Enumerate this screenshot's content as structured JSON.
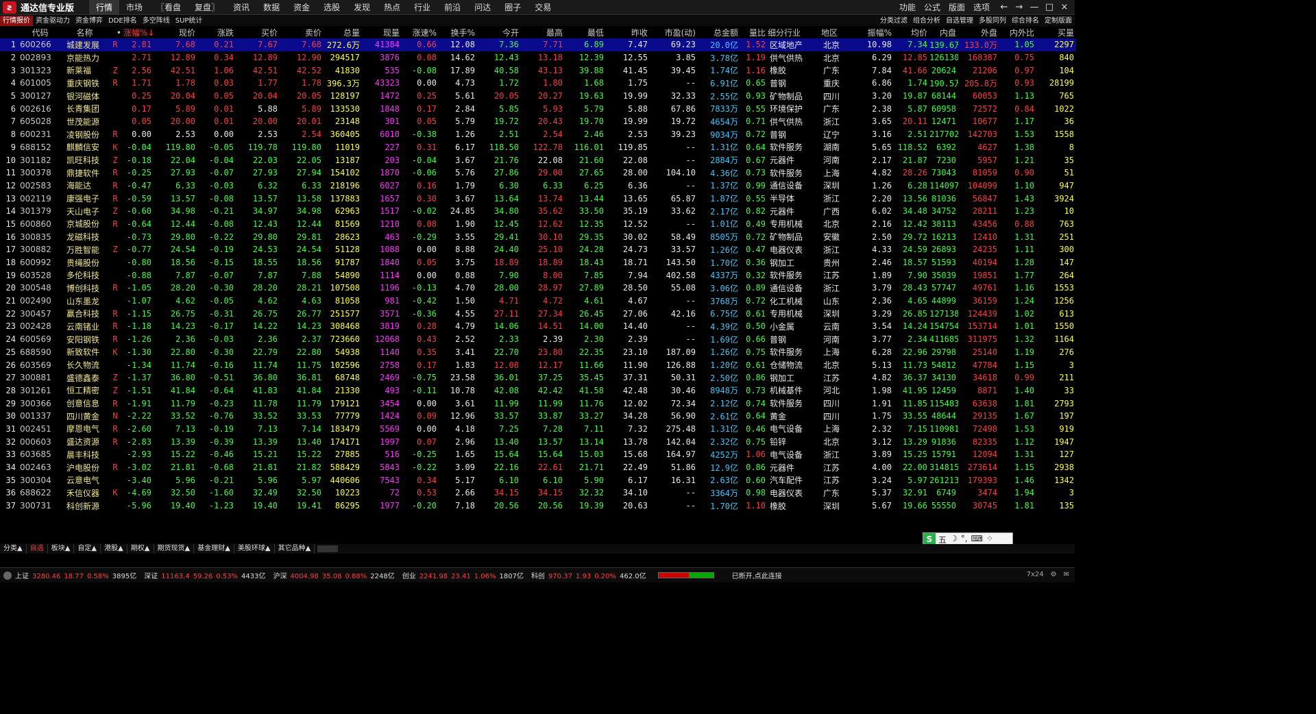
{
  "app": {
    "title": "通达信专业版",
    "logo": "logo-icon"
  },
  "main_menu": [
    "行情",
    "市场",
    "〖看盘",
    "复盘〗",
    "资讯",
    "数据",
    "资金",
    "选股",
    "发现",
    "热点",
    "行业",
    "前沿",
    "问达",
    "圈子",
    "交易"
  ],
  "right_menu": [
    "功能",
    "公式",
    "版面",
    "选项"
  ],
  "window_buttons": [
    "←",
    "→",
    "—",
    "□",
    "×"
  ],
  "tabs_left": [
    "行情报价",
    "资金驱动力",
    "资金博弈",
    "DDE排名",
    "多空阵线",
    "SUP统计"
  ],
  "tabs_right": [
    "分类过滤",
    "组合分析",
    "自选管理",
    "多股同列",
    "综合排名",
    "定制版面"
  ],
  "columns": [
    "",
    "代码",
    "名称",
    "•",
    "涨幅%↓",
    "现价",
    "涨跌",
    "买价",
    "卖价",
    "总量",
    "现量",
    "涨速%",
    "换手%",
    "今开",
    "最高",
    "最低",
    "昨收",
    "市盈(动)",
    "总金额",
    "量比",
    "细分行业",
    "地区",
    "振幅%",
    "均价",
    "内盘",
    "外盘",
    "内外比",
    "买量"
  ],
  "rows": [
    [
      "1",
      "600266",
      "城建发展",
      "R",
      "2.81",
      "7.68",
      "0.21",
      "7.67",
      "7.68",
      "272.6万",
      "41384",
      "0.66",
      "12.08",
      "7.36",
      "7.71",
      "6.89",
      "7.47",
      "69.23",
      "20.0亿",
      "1.52",
      "区域地产",
      "北京",
      "10.98",
      "7.34",
      "139.6万",
      "133.0万",
      "1.05",
      "2297"
    ],
    [
      "2",
      "002893",
      "京能热力",
      "",
      "2.71",
      "12.89",
      "0.34",
      "12.89",
      "12.90",
      "294517",
      "3876",
      "0.08",
      "14.62",
      "12.43",
      "13.18",
      "12.39",
      "12.55",
      "3.85",
      "3.78亿",
      "1.19",
      "供气供热",
      "北京",
      "6.29",
      "12.85",
      "126130",
      "168387",
      "0.75",
      "840"
    ],
    [
      "3",
      "301323",
      "新莱福",
      "Z",
      "2.56",
      "42.51",
      "1.06",
      "42.51",
      "42.52",
      "41830",
      "535",
      "-0.08",
      "17.89",
      "40.58",
      "43.13",
      "39.88",
      "41.45",
      "39.45",
      "1.74亿",
      "1.16",
      "橡胶",
      "广东",
      "7.84",
      "41.66",
      "20624",
      "21206",
      "0.97",
      "104"
    ],
    [
      "4",
      "601005",
      "重庆钢铁",
      "R",
      "1.71",
      "1.78",
      "0.03",
      "1.77",
      "1.78",
      "396.3万",
      "43323",
      "0.00",
      "4.73",
      "1.72",
      "1.80",
      "1.68",
      "1.75",
      "--",
      "6.91亿",
      "0.65",
      "普钢",
      "重庆",
      "6.86",
      "1.74",
      "190.5万",
      "205.8万",
      "0.93",
      "28199"
    ],
    [
      "5",
      "300127",
      "银河磁体",
      "",
      "0.25",
      "20.04",
      "0.05",
      "20.04",
      "20.05",
      "128197",
      "1472",
      "0.25",
      "5.61",
      "20.05",
      "20.27",
      "19.63",
      "19.99",
      "32.33",
      "2.55亿",
      "0.93",
      "矿物制品",
      "四川",
      "3.20",
      "19.87",
      "68144",
      "60053",
      "1.13",
      "765"
    ],
    [
      "6",
      "002616",
      "长青集团",
      "",
      "0.17",
      "5.89",
      "0.01",
      "5.88",
      "5.89",
      "133530",
      "1848",
      "0.17",
      "2.84",
      "5.85",
      "5.93",
      "5.79",
      "5.88",
      "67.86",
      "7833万",
      "0.55",
      "环境保护",
      "广东",
      "2.38",
      "5.87",
      "60958",
      "72572",
      "0.84",
      "1022"
    ],
    [
      "7",
      "605028",
      "世茂能源",
      "",
      "0.05",
      "20.00",
      "0.01",
      "20.00",
      "20.01",
      "23148",
      "301",
      "0.05",
      "5.79",
      "19.72",
      "20.43",
      "19.70",
      "19.99",
      "19.72",
      "4654万",
      "0.71",
      "供气供热",
      "浙江",
      "3.65",
      "20.11",
      "12471",
      "10677",
      "1.17",
      "36"
    ],
    [
      "8",
      "600231",
      "凌钢股份",
      "R",
      "0.00",
      "2.53",
      "0.00",
      "2.53",
      "2.54",
      "360405",
      "6010",
      "-0.38",
      "1.26",
      "2.51",
      "2.54",
      "2.46",
      "2.53",
      "39.23",
      "9034万",
      "0.72",
      "普钢",
      "辽宁",
      "3.16",
      "2.51",
      "217702",
      "142703",
      "1.53",
      "1558"
    ],
    [
      "9",
      "688152",
      "麒麟信安",
      "K",
      "-0.04",
      "119.80",
      "-0.05",
      "119.78",
      "119.80",
      "11019",
      "227",
      "0.31",
      "6.17",
      "118.50",
      "122.78",
      "116.01",
      "119.85",
      "--",
      "1.31亿",
      "0.64",
      "软件服务",
      "湖南",
      "5.65",
      "118.52",
      "6392",
      "4627",
      "1.38",
      "8"
    ],
    [
      "10",
      "301182",
      "凯旺科技",
      "Z",
      "-0.18",
      "22.04",
      "-0.04",
      "22.03",
      "22.05",
      "13187",
      "203",
      "-0.04",
      "3.67",
      "21.76",
      "22.08",
      "21.60",
      "22.08",
      "--",
      "2884万",
      "0.67",
      "元器件",
      "河南",
      "2.17",
      "21.87",
      "7230",
      "5957",
      "1.21",
      "35"
    ],
    [
      "11",
      "300378",
      "鼎捷软件",
      "R",
      "-0.25",
      "27.93",
      "-0.07",
      "27.93",
      "27.94",
      "154102",
      "1870",
      "-0.06",
      "5.76",
      "27.86",
      "29.00",
      "27.65",
      "28.00",
      "104.10",
      "4.36亿",
      "0.73",
      "软件服务",
      "上海",
      "4.82",
      "28.26",
      "73043",
      "81059",
      "0.90",
      "51"
    ],
    [
      "12",
      "002583",
      "海能达",
      "R",
      "-0.47",
      "6.33",
      "-0.03",
      "6.32",
      "6.33",
      "218196",
      "6027",
      "0.16",
      "1.79",
      "6.30",
      "6.33",
      "6.25",
      "6.36",
      "--",
      "1.37亿",
      "0.99",
      "通信设备",
      "深圳",
      "1.26",
      "6.28",
      "114097",
      "104099",
      "1.10",
      "947"
    ],
    [
      "13",
      "002119",
      "康强电子",
      "R",
      "-0.59",
      "13.57",
      "-0.08",
      "13.57",
      "13.58",
      "137883",
      "1657",
      "0.30",
      "3.67",
      "13.64",
      "13.74",
      "13.44",
      "13.65",
      "65.87",
      "1.87亿",
      "0.55",
      "半导体",
      "浙江",
      "2.20",
      "13.56",
      "81036",
      "56847",
      "1.43",
      "3924"
    ],
    [
      "14",
      "301379",
      "天山电子",
      "Z",
      "-0.60",
      "34.98",
      "-0.21",
      "34.97",
      "34.98",
      "62963",
      "1517",
      "-0.02",
      "24.85",
      "34.80",
      "35.62",
      "33.50",
      "35.19",
      "33.62",
      "2.17亿",
      "0.82",
      "元器件",
      "广西",
      "6.02",
      "34.48",
      "34752",
      "28211",
      "1.23",
      "10"
    ],
    [
      "15",
      "600860",
      "京城股份",
      "R",
      "-0.64",
      "12.44",
      "-0.08",
      "12.43",
      "12.44",
      "81569",
      "1210",
      "0.08",
      "1.90",
      "12.45",
      "12.62",
      "12.35",
      "12.52",
      "--",
      "1.01亿",
      "0.49",
      "专用机械",
      "北京",
      "2.16",
      "12.42",
      "38113",
      "43456",
      "0.88",
      "763"
    ],
    [
      "16",
      "300835",
      "龙磁科技",
      "",
      "-0.73",
      "29.80",
      "-0.22",
      "29.80",
      "29.81",
      "28623",
      "463",
      "-0.29",
      "3.55",
      "29.41",
      "30.10",
      "29.35",
      "30.02",
      "58.49",
      "8505万",
      "0.72",
      "矿物制品",
      "安徽",
      "2.50",
      "29.72",
      "16213",
      "12410",
      "1.31",
      "251"
    ],
    [
      "17",
      "300882",
      "万胜智能",
      "Z",
      "-0.77",
      "24.54",
      "-0.19",
      "24.53",
      "24.54",
      "51128",
      "1088",
      "0.00",
      "8.88",
      "24.40",
      "25.10",
      "24.28",
      "24.73",
      "33.57",
      "1.26亿",
      "0.47",
      "电器仪表",
      "浙江",
      "4.33",
      "24.59",
      "26893",
      "24235",
      "1.11",
      "300"
    ],
    [
      "18",
      "600992",
      "贵绳股份",
      "",
      "-0.80",
      "18.56",
      "-0.15",
      "18.55",
      "18.56",
      "91787",
      "1840",
      "0.05",
      "3.75",
      "18.89",
      "18.89",
      "18.43",
      "18.71",
      "143.50",
      "1.70亿",
      "0.36",
      "钢加工",
      "贵州",
      "2.46",
      "18.57",
      "51593",
      "40194",
      "1.28",
      "147"
    ],
    [
      "19",
      "603528",
      "多伦科技",
      "",
      "-0.88",
      "7.87",
      "-0.07",
      "7.87",
      "7.88",
      "54890",
      "1114",
      "0.00",
      "0.88",
      "7.90",
      "8.00",
      "7.85",
      "7.94",
      "402.58",
      "4337万",
      "0.32",
      "软件服务",
      "江苏",
      "1.89",
      "7.90",
      "35039",
      "19851",
      "1.77",
      "264"
    ],
    [
      "20",
      "300548",
      "博创科技",
      "R",
      "-1.05",
      "28.20",
      "-0.30",
      "28.20",
      "28.21",
      "107508",
      "1196",
      "-0.13",
      "4.70",
      "28.00",
      "28.97",
      "27.89",
      "28.50",
      "55.08",
      "3.06亿",
      "0.89",
      "通信设备",
      "浙江",
      "3.79",
      "28.43",
      "57747",
      "49761",
      "1.16",
      "1553"
    ],
    [
      "21",
      "002490",
      "山东墨龙",
      "",
      "-1.07",
      "4.62",
      "-0.05",
      "4.62",
      "4.63",
      "81058",
      "981",
      "-0.42",
      "1.50",
      "4.71",
      "4.72",
      "4.61",
      "4.67",
      "--",
      "3768万",
      "0.72",
      "化工机械",
      "山东",
      "2.36",
      "4.65",
      "44899",
      "36159",
      "1.24",
      "1256"
    ],
    [
      "22",
      "300457",
      "赢合科技",
      "R",
      "-1.15",
      "26.75",
      "-0.31",
      "26.75",
      "26.77",
      "251577",
      "3571",
      "-0.36",
      "4.55",
      "27.11",
      "27.34",
      "26.45",
      "27.06",
      "42.16",
      "6.75亿",
      "0.61",
      "专用机械",
      "深圳",
      "3.29",
      "26.85",
      "127138",
      "124439",
      "1.02",
      "613"
    ],
    [
      "23",
      "002428",
      "云南锗业",
      "R",
      "-1.18",
      "14.23",
      "-0.17",
      "14.22",
      "14.23",
      "308468",
      "3819",
      "0.28",
      "4.79",
      "14.06",
      "14.51",
      "14.00",
      "14.40",
      "--",
      "4.39亿",
      "0.50",
      "小金属",
      "云南",
      "3.54",
      "14.24",
      "154754",
      "153714",
      "1.01",
      "1550"
    ],
    [
      "24",
      "600569",
      "安阳钢铁",
      "R",
      "-1.26",
      "2.36",
      "-0.03",
      "2.36",
      "2.37",
      "723660",
      "12068",
      "0.43",
      "2.52",
      "2.33",
      "2.39",
      "2.30",
      "2.39",
      "--",
      "1.69亿",
      "0.66",
      "普钢",
      "河南",
      "3.77",
      "2.34",
      "411685",
      "311975",
      "1.32",
      "1164"
    ],
    [
      "25",
      "688590",
      "新致软件",
      "K",
      "-1.30",
      "22.80",
      "-0.30",
      "22.79",
      "22.80",
      "54938",
      "1140",
      "0.35",
      "3.41",
      "22.70",
      "23.80",
      "22.35",
      "23.10",
      "187.09",
      "1.26亿",
      "0.75",
      "软件服务",
      "上海",
      "6.28",
      "22.96",
      "29798",
      "25140",
      "1.19",
      "276"
    ],
    [
      "26",
      "603569",
      "长久物流",
      "",
      "-1.34",
      "11.74",
      "-0.16",
      "11.74",
      "11.75",
      "102596",
      "2758",
      "0.17",
      "1.83",
      "12.08",
      "12.17",
      "11.66",
      "11.90",
      "126.88",
      "1.20亿",
      "0.61",
      "仓储物流",
      "北京",
      "5.13",
      "11.73",
      "54812",
      "47784",
      "1.15",
      "3"
    ],
    [
      "27",
      "300881",
      "盛德鑫泰",
      "Z",
      "-1.37",
      "36.80",
      "-0.51",
      "36.80",
      "36.81",
      "68748",
      "2469",
      "-0.75",
      "23.58",
      "36.01",
      "37.25",
      "35.45",
      "37.31",
      "50.31",
      "2.50亿",
      "0.86",
      "钢加工",
      "江苏",
      "4.82",
      "36.37",
      "34130",
      "34618",
      "0.99",
      "211"
    ],
    [
      "28",
      "301261",
      "恒工精密",
      "Z",
      "-1.51",
      "41.84",
      "-0.64",
      "41.83",
      "41.84",
      "21330",
      "493",
      "-0.11",
      "10.78",
      "42.08",
      "42.42",
      "41.58",
      "42.48",
      "30.46",
      "8948万",
      "0.73",
      "机械基件",
      "河北",
      "1.98",
      "41.95",
      "12459",
      "8871",
      "1.40",
      "33"
    ],
    [
      "29",
      "300366",
      "创意信息",
      "R",
      "-1.91",
      "11.79",
      "-0.23",
      "11.78",
      "11.79",
      "179121",
      "3454",
      "0.00",
      "3.61",
      "11.99",
      "11.99",
      "11.76",
      "12.02",
      "72.34",
      "2.12亿",
      "0.74",
      "软件服务",
      "四川",
      "1.91",
      "11.85",
      "115483",
      "63638",
      "1.81",
      "2793"
    ],
    [
      "30",
      "001337",
      "四川黄金",
      "N",
      "-2.22",
      "33.52",
      "-0.76",
      "33.52",
      "33.53",
      "77779",
      "1424",
      "0.09",
      "12.96",
      "33.57",
      "33.87",
      "33.27",
      "34.28",
      "56.90",
      "2.61亿",
      "0.64",
      "黄金",
      "四川",
      "1.75",
      "33.55",
      "48644",
      "29135",
      "1.67",
      "197"
    ],
    [
      "31",
      "002451",
      "摩恩电气",
      "R",
      "-2.60",
      "7.13",
      "-0.19",
      "7.13",
      "7.14",
      "183479",
      "5569",
      "0.00",
      "4.18",
      "7.25",
      "7.28",
      "7.11",
      "7.32",
      "275.48",
      "1.31亿",
      "0.46",
      "电气设备",
      "上海",
      "2.32",
      "7.15",
      "110981",
      "72498",
      "1.53",
      "919"
    ],
    [
      "32",
      "000603",
      "盛达资源",
      "R",
      "-2.83",
      "13.39",
      "-0.39",
      "13.39",
      "13.40",
      "174171",
      "1997",
      "0.07",
      "2.96",
      "13.40",
      "13.57",
      "13.14",
      "13.78",
      "142.04",
      "2.32亿",
      "0.75",
      "铅锌",
      "北京",
      "3.12",
      "13.29",
      "91836",
      "82335",
      "1.12",
      "1947"
    ],
    [
      "33",
      "603685",
      "晨丰科技",
      "",
      "-2.93",
      "15.22",
      "-0.46",
      "15.21",
      "15.22",
      "27885",
      "516",
      "-0.25",
      "1.65",
      "15.64",
      "15.64",
      "15.03",
      "15.68",
      "164.97",
      "4252万",
      "1.06",
      "电气设备",
      "浙江",
      "3.89",
      "15.25",
      "15791",
      "12094",
      "1.31",
      "127"
    ],
    [
      "34",
      "002463",
      "沪电股份",
      "R",
      "-3.02",
      "21.81",
      "-0.68",
      "21.81",
      "21.82",
      "588429",
      "5843",
      "-0.22",
      "3.09",
      "22.16",
      "22.61",
      "21.71",
      "22.49",
      "51.86",
      "12.9亿",
      "0.86",
      "元器件",
      "江苏",
      "4.00",
      "22.00",
      "314815",
      "273614",
      "1.15",
      "2938"
    ],
    [
      "35",
      "300304",
      "云意电气",
      "",
      "-3.40",
      "5.96",
      "-0.21",
      "5.96",
      "5.97",
      "440606",
      "7543",
      "0.34",
      "5.17",
      "6.10",
      "6.10",
      "5.90",
      "6.17",
      "16.31",
      "2.63亿",
      "0.60",
      "汽车配件",
      "江苏",
      "3.24",
      "5.97",
      "261213",
      "179393",
      "1.46",
      "1342"
    ],
    [
      "36",
      "688622",
      "禾信仪器",
      "K",
      "-4.69",
      "32.50",
      "-1.60",
      "32.49",
      "32.50",
      "10223",
      "72",
      "0.53",
      "2.66",
      "34.15",
      "34.15",
      "32.32",
      "34.10",
      "--",
      "3364万",
      "0.98",
      "电器仪表",
      "广东",
      "5.37",
      "32.91",
      "6749",
      "3474",
      "1.94",
      "3"
    ],
    [
      "37",
      "300731",
      "科创新源",
      "",
      "-5.96",
      "19.40",
      "-1.23",
      "19.40",
      "19.41",
      "86295",
      "1977",
      "-0.20",
      "7.18",
      "20.56",
      "20.56",
      "19.39",
      "20.63",
      "--",
      "1.70亿",
      "1.10",
      "橡胶",
      "深圳",
      "5.67",
      "19.66",
      "55550",
      "30745",
      "1.81",
      "135"
    ]
  ],
  "bottom_tabs": [
    "分类▲",
    "自选",
    "板块▲",
    "自定▲",
    "港股▲",
    "期权▲",
    "期货现货▲",
    "基金理财▲",
    "美股环球▲",
    "其它品种▲"
  ],
  "ime": {
    "logo": "S",
    "items": [
      "五",
      "☽",
      "°,",
      "⌨",
      "⁘"
    ]
  },
  "status": {
    "items": [
      {
        "label": "上证",
        "value": "3280.46",
        "change": "18.77",
        "pct": "0.58%",
        "amount": "3895亿",
        "color": "#ff3c3c"
      },
      {
        "label": "深证",
        "value": "11163.4",
        "change": "59.26",
        "pct": "0.53%",
        "amount": "4433亿",
        "color": "#ff3c3c"
      },
      {
        "label": "沪深",
        "value": "4004.98",
        "change": "35.08",
        "pct": "0.88%",
        "amount": "2248亿",
        "color": "#ff3c3c"
      },
      {
        "label": "创业",
        "value": "2241.98",
        "change": "23.41",
        "pct": "1.06%",
        "amount": "1807亿",
        "color": "#ff3c3c"
      },
      {
        "label": "科创",
        "value": "970.37",
        "change": "1.93",
        "pct": "0.20%",
        "amount": "462.0亿",
        "color": "#ff3c3c"
      }
    ],
    "connection": "已断开,点此连接",
    "trading": "7x24"
  }
}
